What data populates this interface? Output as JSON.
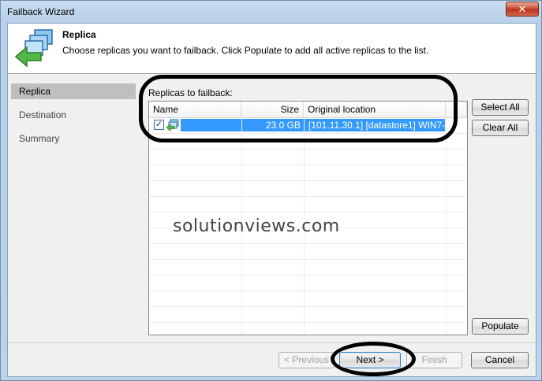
{
  "window": {
    "title": "Failback Wizard",
    "close_glyph": "✕"
  },
  "header": {
    "title": "Replica",
    "description": "Choose replicas you want to failback. Click Populate to add all active replicas to the list.",
    "icon": "replica-failback-icon"
  },
  "steps": [
    {
      "label": "Replica",
      "active": true
    },
    {
      "label": "Destination",
      "active": false
    },
    {
      "label": "Summary",
      "active": false
    }
  ],
  "replicas": {
    "group_label": "Replicas to failback:",
    "columns": [
      "Name",
      "Size",
      "Original location"
    ],
    "rows": [
      {
        "checked": true,
        "check_glyph": "✓",
        "name": "",
        "size": "23.0 GB",
        "location": "[101.11.30.1] [datastore1] WIN7-..."
      }
    ]
  },
  "side_buttons": {
    "select_all": "Select All",
    "clear_all": "Clear All",
    "populate": "Populate"
  },
  "footer": {
    "previous": "< Previous",
    "next": "Next >",
    "finish": "Finish",
    "cancel": "Cancel"
  },
  "watermark": "solutionviews.com",
  "colors": {
    "selection": "#3399ff",
    "close_button": "#c8482e",
    "annotation": "#000000"
  }
}
